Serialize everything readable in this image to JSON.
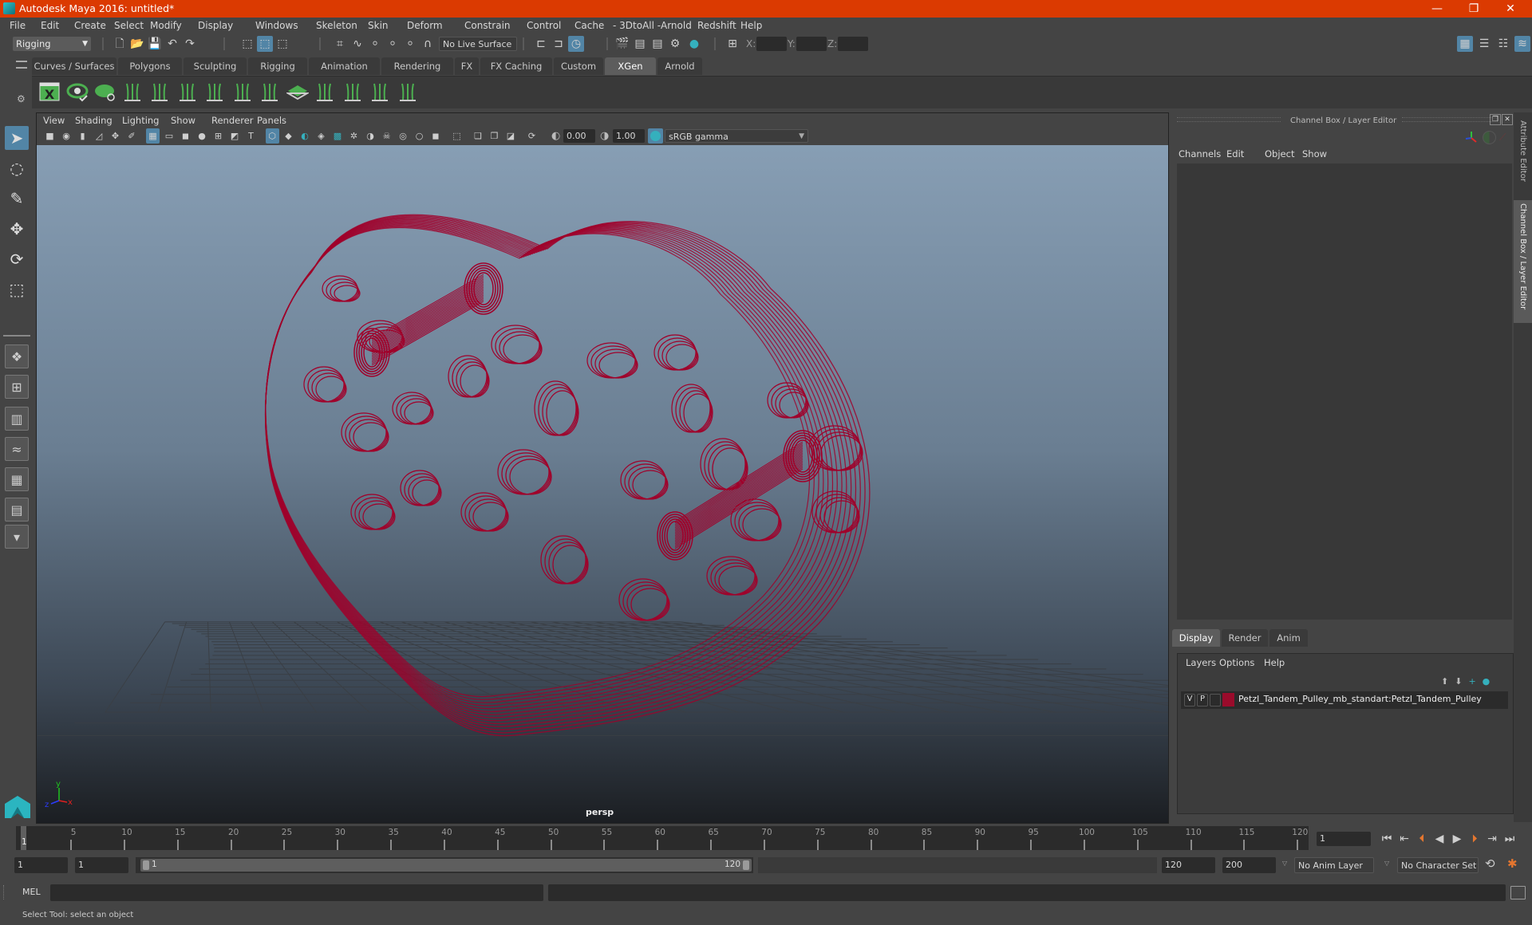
{
  "window": {
    "title": "Autodesk Maya 2016: untitled*",
    "controls": {
      "minimize": "—",
      "maximize": "❐",
      "close": "✕"
    }
  },
  "menubar": [
    "File",
    "Edit",
    "Create",
    "Select",
    "Modify",
    "Display",
    "Windows",
    "Skeleton",
    "Skin",
    "Deform",
    "Constrain",
    "Control",
    "Cache",
    "- 3DtoAll -",
    "Arnold",
    "Redshift",
    "Help"
  ],
  "statusline": {
    "menuset": "Rigging",
    "live_surface": "No Live Surface",
    "coord_labels": {
      "x": "X:",
      "y": "Y:",
      "z": "Z:"
    },
    "coord_values": {
      "x": "",
      "y": "",
      "z": ""
    },
    "icons": [
      "new-scene",
      "open-scene",
      "save-scene",
      "undo",
      "redo",
      "select-by-hierarchy",
      "select-by-object-type",
      "select-by-component-type",
      "snap-to-grid",
      "snap-to-curve",
      "snap-to-point",
      "snap-to-view-plane",
      "snap-to-projected-center",
      "make-live",
      "input-ops",
      "output-ops",
      "construction-history",
      "render-current-frame",
      "render-sequence",
      "ipr-render",
      "render-settings",
      "hypershade",
      "camera-gate",
      "sidebar-modeling-toolkit",
      "sidebar-attribute-editor",
      "sidebar-tool-settings",
      "sidebar-channel-box"
    ]
  },
  "shelf": {
    "tabs": [
      "Curves / Surfaces",
      "Polygons",
      "Sculpting",
      "Rigging",
      "Animation",
      "Rendering",
      "FX",
      "FX Caching",
      "Custom",
      "XGen",
      "Arnold"
    ],
    "active_tab": "XGen",
    "icons": [
      "xgen-window",
      "xgen-preview",
      "xgen-clear-preview",
      "xgen-add-guides",
      "xgen-place-guides",
      "xgen-add-guide",
      "xgen-show-guide",
      "xgen-lock-guide",
      "xgen-guide-split",
      "xgen-region-map",
      "xgen-flip-guides",
      "xgen-select-guides",
      "xgen-guide-bounds",
      "xgen-delete-guide"
    ]
  },
  "toolbox": [
    "select-tool",
    "lasso-tool",
    "paint-select-tool",
    "move-tool",
    "rotate-tool",
    "scale-tool",
    "single-perspective-layout",
    "four-view-layout",
    "outliner-persp-layout",
    "persp-graph-layout",
    "hypershade-persp-layout",
    "persp-graph-outliner-layout",
    "more-layouts"
  ],
  "viewport": {
    "menu": [
      "View",
      "Shading",
      "Lighting",
      "Show",
      "Renderer",
      "Panels"
    ],
    "exposure": "0.00",
    "gamma": "1.00",
    "color_management": "sRGB gamma",
    "camera_label": "persp",
    "axis": {
      "x": "x",
      "y": "y",
      "z": "z"
    },
    "wireframe_color": "#a0002a"
  },
  "channelbox": {
    "header": "Channel Box / Layer Editor",
    "menu": [
      "Channels",
      "Edit",
      "Object",
      "Show"
    ]
  },
  "layer_editor": {
    "tabs": [
      "Display",
      "Render",
      "Anim"
    ],
    "active_tab": "Display",
    "menu": [
      "Layers",
      "Options",
      "Help"
    ],
    "layers": [
      {
        "visible": "V",
        "playback": "P",
        "color": "#9a0b2b",
        "name": "Petzl_Tandem_Pulley_mb_standart:Petzl_Tandem_Pulley"
      }
    ]
  },
  "side_tabs": [
    "Attribute Editor",
    "Channel Box / Layer Editor"
  ],
  "timeline": {
    "ticks": [
      5,
      10,
      15,
      20,
      25,
      30,
      35,
      40,
      45,
      50,
      55,
      60,
      65,
      70,
      75,
      80,
      85,
      90,
      95,
      100,
      105,
      110,
      115,
      120
    ],
    "start": 1,
    "end": 120,
    "current_frame": "1",
    "current_marker": "1"
  },
  "range": {
    "start": "1",
    "playback_start": "1",
    "slider_start": "1",
    "slider_end": "120",
    "playback_end": "120",
    "end": "200",
    "anim_layer": "No Anim Layer",
    "character_set": "No Character Set"
  },
  "cmdline": {
    "label": "MEL",
    "value": "",
    "result": ""
  },
  "helpline": "Select Tool: select an object",
  "colors": {
    "titlebar": "#db3a01",
    "accent": "#5285a6",
    "highlight_orange": "#e5762f",
    "teal": "#35b0bd",
    "shelf_green": "#4caf50"
  }
}
